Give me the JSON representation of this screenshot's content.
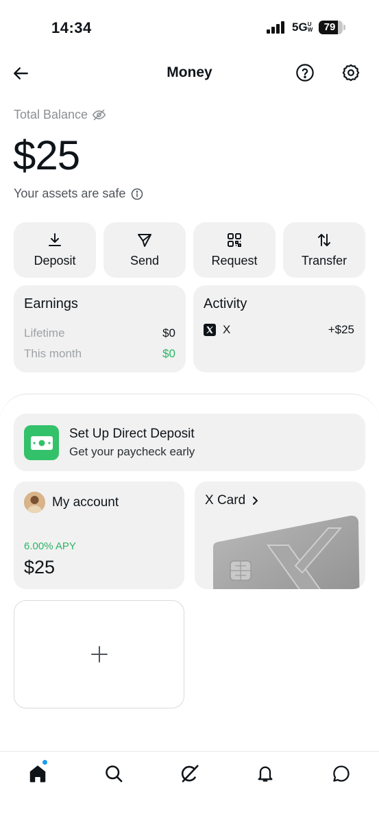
{
  "status_bar": {
    "time": "14:34",
    "network": "5G",
    "network_badge": "UW",
    "battery": "79",
    "battery_level": 0.79
  },
  "header": {
    "title": "Money",
    "icons": [
      "back-arrow-icon",
      "help-icon",
      "settings-icon"
    ]
  },
  "balance": {
    "label": "Total Balance",
    "amount": "$25",
    "safe_text": "Your assets are safe"
  },
  "actions": [
    {
      "label": "Deposit",
      "icon": "download-icon"
    },
    {
      "label": "Send",
      "icon": "send-icon"
    },
    {
      "label": "Request",
      "icon": "qr-code-icon"
    },
    {
      "label": "Transfer",
      "icon": "transfer-icon"
    }
  ],
  "earnings": {
    "title": "Earnings",
    "rows": [
      {
        "label": "Lifetime",
        "value": "$0"
      },
      {
        "label": "This month",
        "value": "$0"
      }
    ]
  },
  "activity": {
    "title": "Activity",
    "items": [
      {
        "name": "X",
        "amount": "+$25"
      }
    ]
  },
  "direct_deposit": {
    "title": "Set Up Direct Deposit",
    "subtitle": "Get your paycheck early"
  },
  "account": {
    "title": "My account",
    "apy": "6.00% APY",
    "amount": "$25"
  },
  "x_card": {
    "title": "X Card"
  },
  "colors": {
    "accent_green": "#2bb566",
    "card_bg": "#f1f1f1",
    "notification_dot": "#1d9bf0"
  },
  "tabs": [
    "home-icon",
    "search-icon",
    "grok-icon",
    "notifications-icon",
    "messages-icon"
  ]
}
